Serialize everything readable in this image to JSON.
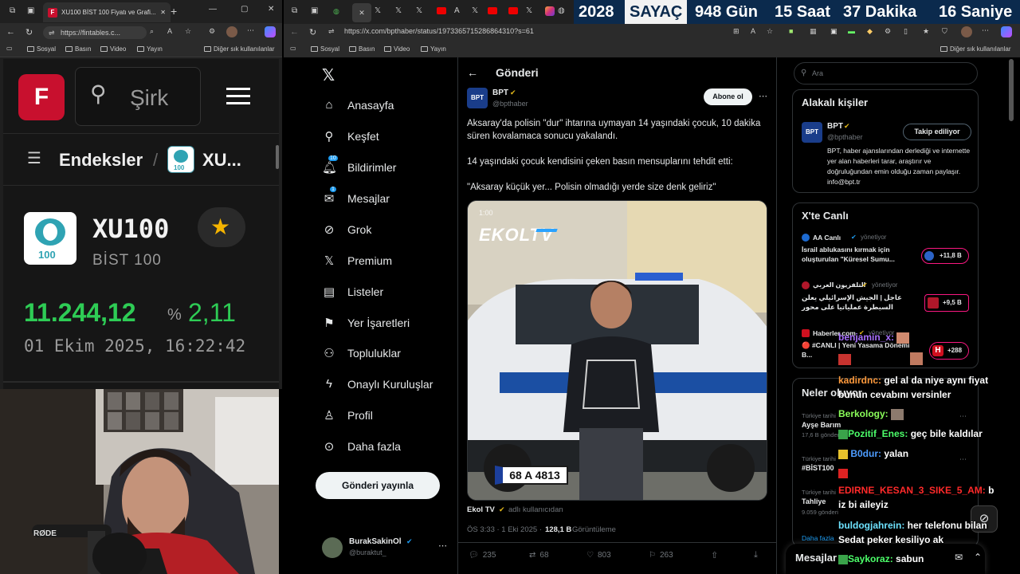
{
  "left_browser": {
    "tab_title": "XU100 BİST 100 Fiyatı ve Grafi...",
    "url": "https://fintables.c...",
    "bookmarks": [
      "Sosyal",
      "Basın",
      "Video",
      "Yayın"
    ],
    "bookmarks_other": "Diğer sık kullanılanlar"
  },
  "fintables": {
    "logo_letter": "F",
    "search_placeholder": "Şirk",
    "breadcrumb_root": "Endeksler",
    "breadcrumb_current": "XU...",
    "badge_number": "100",
    "symbol": "XU100",
    "name": "BİST 100",
    "price": "11.244,12",
    "change_prefix": "%",
    "change": "2,11",
    "datetime": "01 Ekim 2025, 16:22:42"
  },
  "counter": {
    "year": "2028",
    "label": "SAYAÇ",
    "days": "948 Gün",
    "hours": "15 Saat",
    "minutes": "37 Dakika",
    "seconds": "16 Saniye"
  },
  "right_browser": {
    "url": "https://x.com/bpthaber/status/1973365715286864310?s=61",
    "bookmarks": [
      "Sosyal",
      "Basın",
      "Video",
      "Yayın"
    ],
    "bookmarks_other": "Diğer sık kullanılanlar"
  },
  "x_nav": {
    "items": [
      "Anasayfa",
      "Keşfet",
      "Bildirimler",
      "Mesajlar",
      "Grok",
      "Premium",
      "Listeler",
      "Yer İşaretleri",
      "Topluluklar",
      "Onaylı Kuruluşlar",
      "Profil",
      "Daha fazla"
    ],
    "notif_badge": "10",
    "msg_badge": "1",
    "post_button": "Gönderi yayınla",
    "account_name": "BurakSakinOl",
    "account_handle": "@buraktut_"
  },
  "post": {
    "header": "Gönderi",
    "author": "BPT",
    "handle": "@bpthaber",
    "subscribe": "Abone ol",
    "text1": "Aksaray'da polisin \"dur\" ihtarına uymayan 14 yaşındaki çocuk, 10 dakika süren kovalamaca sonucu yakalandı.",
    "text2": "14 yaşındaki çocuk kendisini çeken basın mensuplarını tehdit etti:",
    "text3": "\"Aksaray küçük yer... Polisin olmadığı yerde size denk geliriz\"",
    "video_time": "1:00",
    "video_watermark": "EKOLTV",
    "plate": "68 A 4813",
    "source_name": "Ekol TV",
    "source_suffix": "adlı kullanıcıdan",
    "meta_time": "ÖS 3:33 · 1 Eki 2025 ·",
    "views": "128,1 B",
    "views_label": "Görüntüleme",
    "replies": "235",
    "reposts": "68",
    "likes": "803",
    "bookmarks": "263"
  },
  "sidebar": {
    "search_placeholder": "Ara",
    "related_title": "Alakalı kişiler",
    "related_name": "BPT",
    "related_handle": "@bpthaber",
    "following": "Takip ediliyor",
    "related_bio": "BPT, haber ajanslarından derlediği ve internette yer alan haberleri tarar, araştırır ve doğruluğundan emin olduğu zaman paylaşır. info@bpt.tr",
    "live_title": "X'te Canlı",
    "live": [
      {
        "host": "AA Canlı",
        "status": "yönetiyor",
        "title": "İsrail ablukasını kırmak için oluşturulan \"Küresel Sumu...",
        "count": "+11,8 B"
      },
      {
        "host": "التلفزيون العربي",
        "status": "yönetiyor",
        "title": "عاجل | الجيش الإسرائيلي يعلن السيطرة عملياتيا على محور",
        "count": "+9,5 B"
      },
      {
        "host": "Haberler.com",
        "status": "yönetiyor",
        "title": "🔴 #CANLI | Yeni Yasama Dönemi B...",
        "count": "+288"
      }
    ],
    "whats_title": "Neler oluyor",
    "trends": [
      {
        "meta": "Türkiye tarihi",
        "name": "Ayşe Barım",
        "count": "17,6 B gönderi"
      },
      {
        "meta": "Türkiye tarihi",
        "name": "#BİST100",
        "count": ""
      },
      {
        "meta": "Türkiye tarihi",
        "name": "Tahliye",
        "count": "9.059 gönderi"
      }
    ],
    "more": "Daha fazla",
    "messages": "Mesajlar"
  },
  "chat": [
    {
      "user": "benjamin_x:",
      "msg": "",
      "color": "#a970ff"
    },
    {
      "user": "",
      "msg": "",
      "color": "#ff4d4d"
    },
    {
      "user": "kadirdnc:",
      "msg": "gel al da niye aynı fiyat",
      "color": "#ff9a3c"
    },
    {
      "user": "",
      "msg": "bunun cevabını versinler",
      "color": "#ffffff"
    },
    {
      "user": "Berkology:",
      "msg": "",
      "color": "#8bff5a"
    },
    {
      "user": "Pozitif_Enes:",
      "msg": "geç bile kaldılar",
      "color": "#4cff6a"
    },
    {
      "user": "B0dur:",
      "msg": "yalan",
      "color": "#4d9cff"
    },
    {
      "user": "EDIRNE_KESAN_3_SIKE_5_AM:",
      "msg": "b",
      "color": "#ff2a2a"
    },
    {
      "user": "",
      "msg": "iz bi aileyiz",
      "color": "#ffffff"
    },
    {
      "user": "buldogjahrein:",
      "msg": "her telefonu bilan",
      "color": "#6de2ff"
    },
    {
      "user": "",
      "msg": "Sedat peker kesiliyo ak",
      "color": "#ffffff"
    },
    {
      "user": "Saykoraz:",
      "msg": "sabun",
      "color": "#4cff6a"
    }
  ]
}
